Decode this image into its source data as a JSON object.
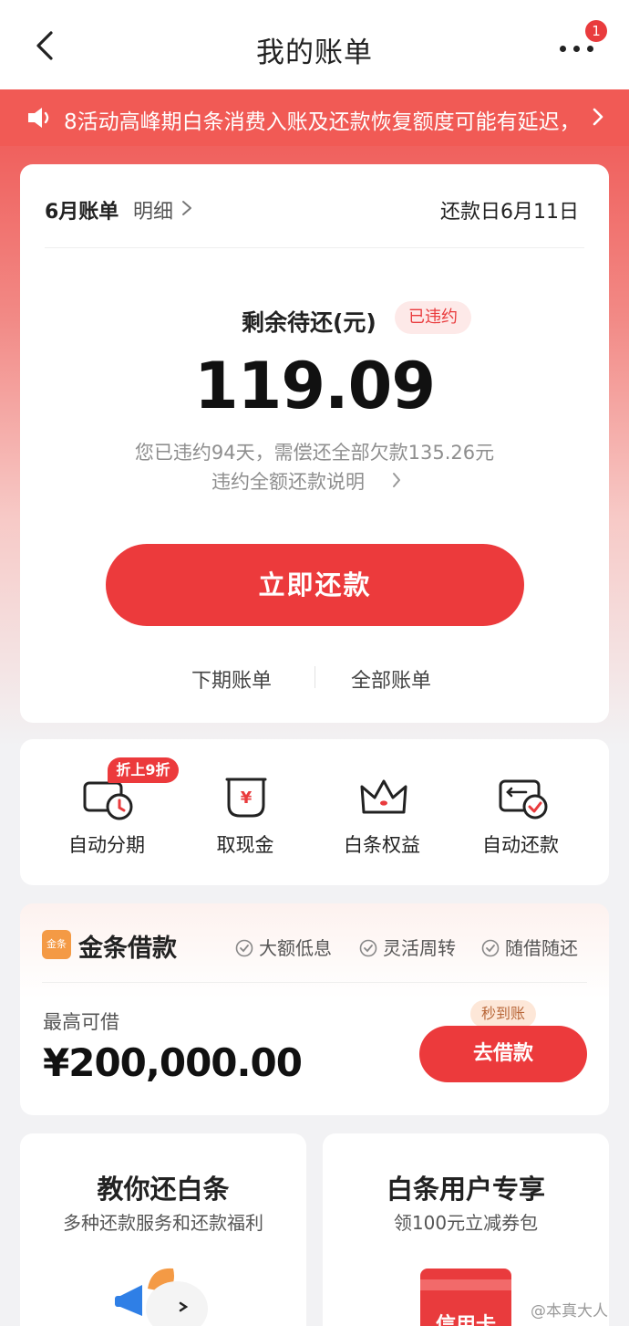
{
  "header": {
    "title": "我的账单",
    "more_badge": "1"
  },
  "notice": {
    "text": "8活动高峰期白条消费入账及还款恢复额度可能有延迟，"
  },
  "bill": {
    "month_label": "6月账单",
    "detail_link": "明细",
    "due_date": "还款日6月11日",
    "remain_label": "剩余待还(元)",
    "status_badge": "已违约",
    "amount": "119.09",
    "overdue_text": "您已违约94天，需偿还全部欠款135.26元",
    "explain_link": "违约全额还款说明",
    "repay_button": "立即还款",
    "next_bill": "下期账单",
    "all_bill": "全部账单"
  },
  "services": {
    "discount_tag": "折上9折",
    "items": [
      {
        "label": "自动分期",
        "icon": "installment-clock-icon"
      },
      {
        "label": "取现金",
        "icon": "cash-withdraw-icon"
      },
      {
        "label": "白条权益",
        "icon": "crown-icon"
      },
      {
        "label": "自动还款",
        "icon": "auto-repay-card-icon"
      }
    ]
  },
  "loan": {
    "logo_text": "金条",
    "title": "金条借款",
    "features": [
      "大额低息",
      "灵活周转",
      "随借随还"
    ],
    "max_label": "最高可借",
    "max_amount": "¥200,000.00",
    "fast_tag": "秒到账",
    "borrow_button": "去借款"
  },
  "promos": [
    {
      "title": "教你还白条",
      "subtitle": "多种还款服务和还款福利"
    },
    {
      "title": "白条用户专享",
      "subtitle": "领100元立减券包",
      "card_text": "信用卡"
    }
  ],
  "watermark": "@本真大人",
  "colors": {
    "accent": "#ec3a3c",
    "notice_bg": "#f15a55",
    "badge_bg": "#fde9e8"
  }
}
